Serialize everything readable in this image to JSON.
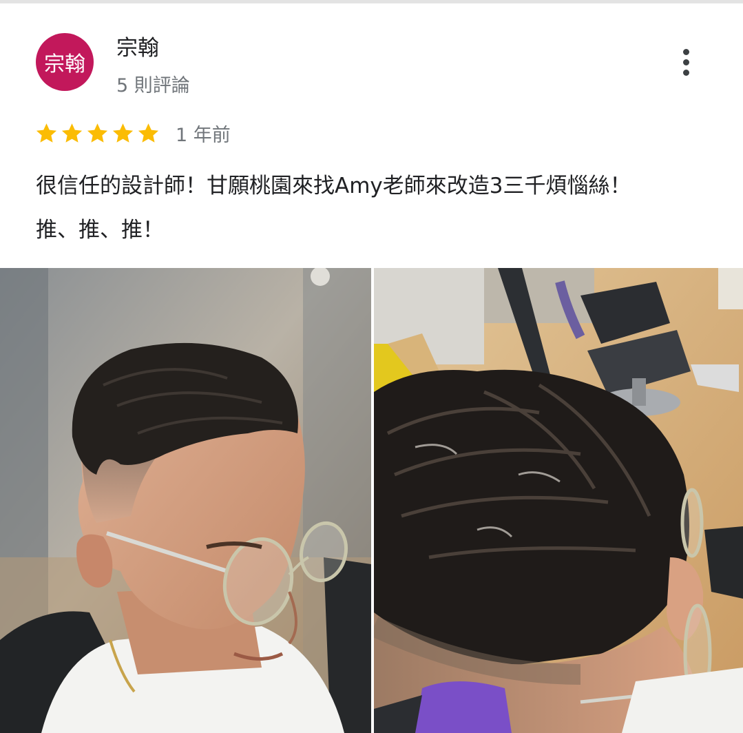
{
  "reviewer": {
    "avatar_text": "宗翰",
    "avatar_color": "#c2185b",
    "name": "宗翰",
    "review_count": "5 則評論"
  },
  "menu": {
    "icon": "more-vert-icon"
  },
  "rating": {
    "stars": 5,
    "max_stars": 5,
    "star_color": "#fbbc04",
    "time_ago": "1 年前"
  },
  "review": {
    "text_line_1": "很信任的設計師！甘願桃園來找Amy老師來改造3三千煩惱絲！",
    "text_line_2": "推、推、推！"
  },
  "photos": [
    {
      "subject": "side-profile-haircut-photo"
    },
    {
      "subject": "top-view-haircut-photo"
    }
  ]
}
